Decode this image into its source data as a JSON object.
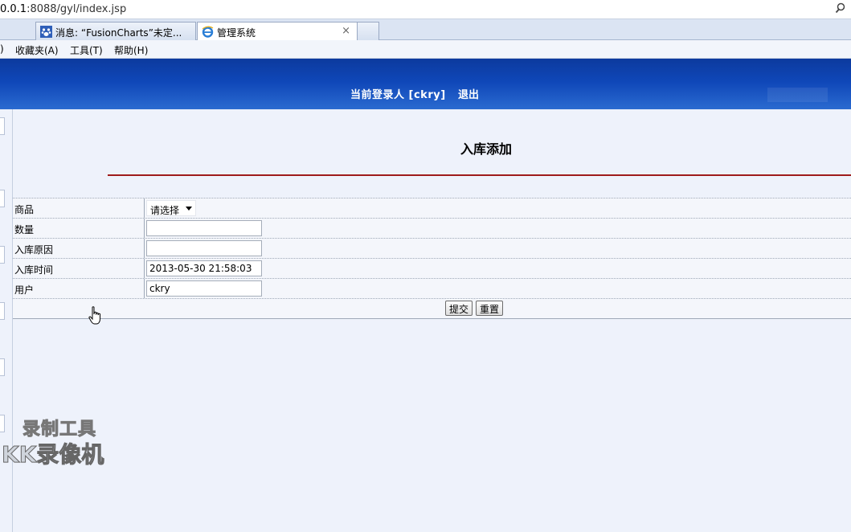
{
  "browser": {
    "url_host": "0.0.1",
    "url_rest": ":8088/gyl/index.jsp",
    "tabs": [
      {
        "title": "消息: “FusionCharts”未定...",
        "active": false
      },
      {
        "title": "管理系统",
        "active": true
      }
    ],
    "tab_close_symbol": "×",
    "menus": [
      ")",
      "收藏夹(A)",
      "工具(T)",
      "帮助(H)"
    ]
  },
  "header": {
    "user_info": "当前登录人 [ckry]",
    "logout": "退出"
  },
  "page": {
    "title": "入库添加",
    "accent_color": "#9e1b1b"
  },
  "form": {
    "fields": [
      {
        "label": "商品",
        "type": "select",
        "value": "请选择"
      },
      {
        "label": "数量",
        "type": "text",
        "value": ""
      },
      {
        "label": "入库原因",
        "type": "text",
        "value": ""
      },
      {
        "label": "入库时间",
        "type": "text",
        "value": "2013-05-30 21:58:03"
      },
      {
        "label": "用户",
        "type": "text",
        "value": "ckry"
      }
    ],
    "submit_label": "提交",
    "reset_label": "重置"
  },
  "watermark": {
    "line1": "录制工具",
    "line2": "KK录像机"
  }
}
